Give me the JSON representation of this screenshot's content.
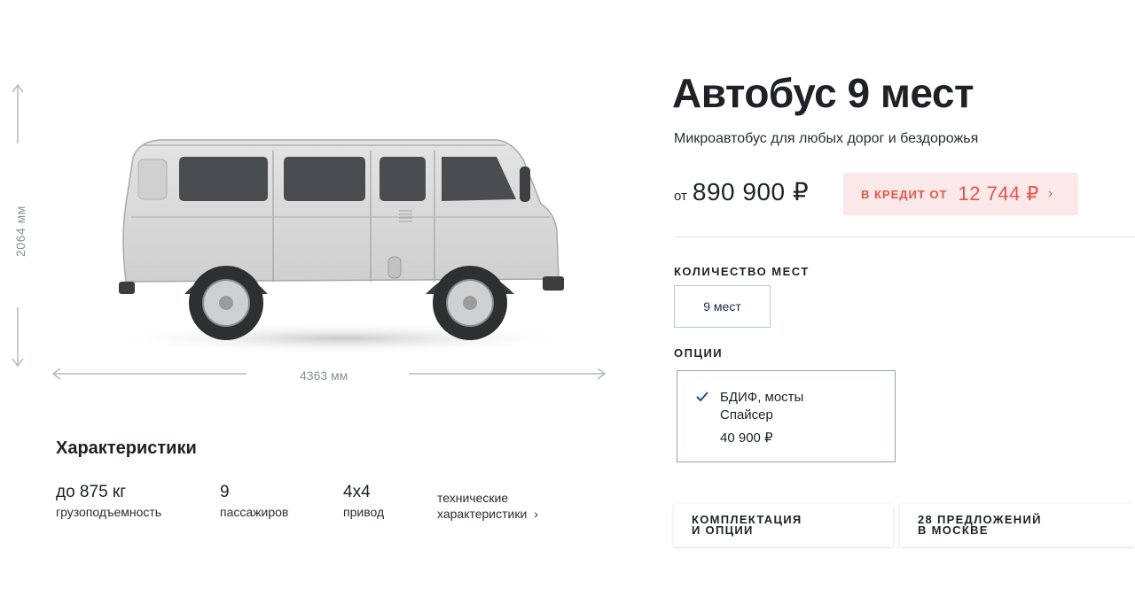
{
  "dimensions": {
    "height": "2064 мм",
    "length": "4363 мм"
  },
  "product": {
    "title": "Автобус 9 мест",
    "subtitle": "Микроавтобус для любых дорог и бездорожья",
    "price_prefix": "от",
    "price": "890 900 ₽",
    "credit_label": "В КРЕДИТ ОТ",
    "credit_value": "12 744 ₽",
    "credit_chevron": "›"
  },
  "seats": {
    "label": "КОЛИЧЕСТВО МЕСТ",
    "selected": "9 мест"
  },
  "options": {
    "label": "ОПЦИИ",
    "items": [
      {
        "name": "БДИФ, мосты Спайсер",
        "price": "40 900 ₽",
        "checked": true
      }
    ]
  },
  "tabs": [
    {
      "label": "КОМПЛЕКТАЦИЯ\nИ ОПЦИИ"
    },
    {
      "label": "28 ПРЕДЛОЖЕНИЙ\nВ МОСКВЕ"
    }
  ],
  "specs": {
    "title": "Характеристики",
    "items": [
      {
        "value": "до 875 кг",
        "label": "грузоподъемность"
      },
      {
        "value": "9",
        "label": "пассажиров"
      },
      {
        "value": "4x4",
        "label": "привод"
      }
    ],
    "tech_link": "технические характеристики",
    "tech_chevron": "›"
  },
  "colors": {
    "credit_bg": "#fbe8e8",
    "credit_text": "#e3564f",
    "option_border": "#8aa3c7",
    "van_body": "#d9d9d9"
  },
  "icons": {
    "check": "check-icon",
    "chevron": "chevron-right-icon",
    "arrows": "dimension-arrow-icon"
  }
}
